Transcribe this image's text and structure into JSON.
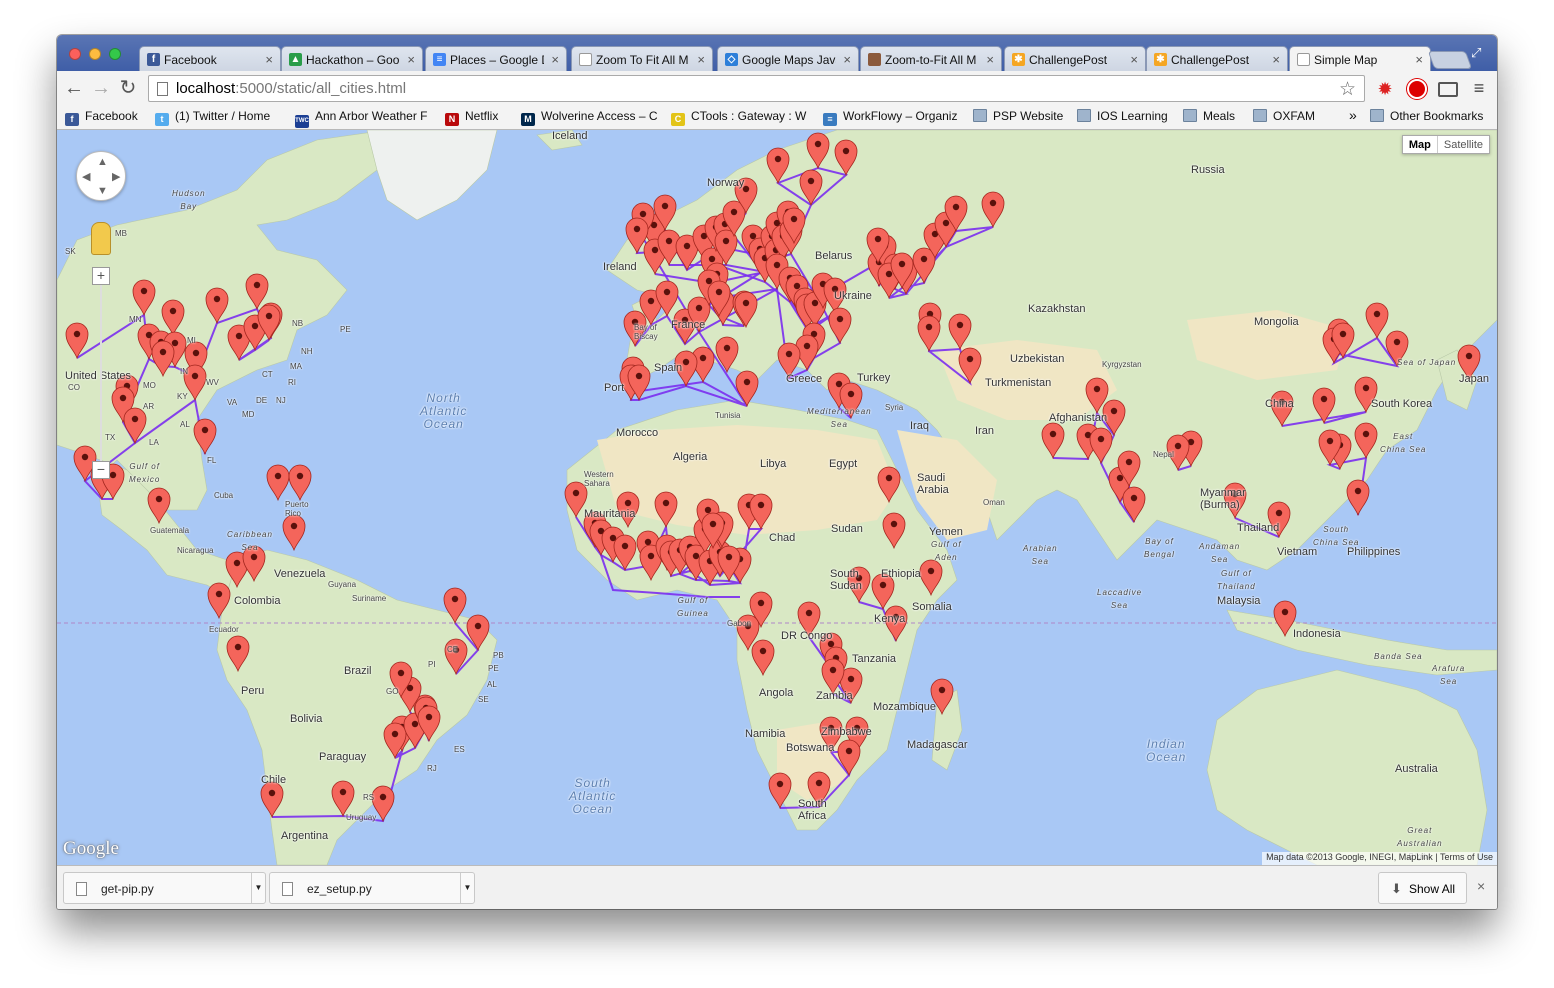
{
  "browser": {
    "tabs": [
      {
        "title": "Facebook",
        "favicon": "facebook-icon",
        "color": "#3b5998",
        "glyph": "f"
      },
      {
        "title": "Hackathon – Goo",
        "favicon": "google-drive-icon",
        "color": "#2a9d4a",
        "glyph": "▲"
      },
      {
        "title": "Places – Google D",
        "favicon": "google-docs-icon",
        "color": "#4285f4",
        "glyph": "≡"
      },
      {
        "title": "Zoom To Fit All M",
        "favicon": "page-icon",
        "color": "#ffffff",
        "glyph": ""
      },
      {
        "title": "Google Maps Java",
        "favicon": "google-code-icon",
        "color": "#2d7fd9",
        "glyph": "◇"
      },
      {
        "title": "Zoom-to-Fit All M",
        "favicon": "avatar-icon",
        "color": "#8b5a3c",
        "glyph": ""
      },
      {
        "title": "ChallengePost",
        "favicon": "challengepost-icon",
        "color": "#f5a623",
        "glyph": "✱"
      },
      {
        "title": "ChallengePost",
        "favicon": "challengepost-icon",
        "color": "#f5a623",
        "glyph": "✱"
      },
      {
        "title": "Simple Map",
        "favicon": "page-icon",
        "color": "#ffffff",
        "glyph": "",
        "active": true
      }
    ],
    "omnibox": {
      "host": "localhost",
      "path": ":5000/static/all_cities.html"
    },
    "bookmarks": [
      {
        "label": "Facebook",
        "icon": "facebook-icon",
        "color": "#3b5998",
        "glyph": "f"
      },
      {
        "label": "(1) Twitter / Home",
        "icon": "twitter-icon",
        "color": "#55acee",
        "glyph": "t"
      },
      {
        "label": "Ann Arbor Weather F",
        "icon": "twc-icon",
        "color": "#1c3f94",
        "glyph": "TWC"
      },
      {
        "label": "Netflix",
        "icon": "netflix-icon",
        "color": "#b9090b",
        "glyph": "N"
      },
      {
        "label": "Wolverine Access – C",
        "icon": "umich-icon",
        "color": "#00274c",
        "glyph": "M"
      },
      {
        "label": "CTools : Gateway : W",
        "icon": "ctools-icon",
        "color": "#e3c417",
        "glyph": "C"
      },
      {
        "label": "WorkFlowy – Organiz",
        "icon": "workflowy-icon",
        "color": "#3a7bbf",
        "glyph": "≡"
      },
      {
        "label": "PSP Website",
        "icon": "folder-icon",
        "folder": true
      },
      {
        "label": "IOS Learning",
        "icon": "folder-icon",
        "folder": true
      },
      {
        "label": "Meals",
        "icon": "folder-icon",
        "folder": true
      },
      {
        "label": "OXFAM",
        "icon": "folder-icon",
        "folder": true
      }
    ],
    "bookmarks_overflow": "»",
    "other_bookmarks": "Other Bookmarks"
  },
  "map": {
    "maptype": {
      "map": "Map",
      "satellite": "Satellite"
    },
    "google_logo": "Google",
    "attribution": "Map data ©2013 Google, INEGI, MapLink",
    "terms": "Terms of Use",
    "zoom_in": "+",
    "zoom_out": "−",
    "labels": {
      "russia": "Russia",
      "norway": "Norway",
      "ireland": "Ireland",
      "iceland": "Iceland",
      "belarus": "Belarus",
      "ukraine": "Ukraine",
      "kazakhstan": "Kazakhstan",
      "mongolia": "Mongolia",
      "france": "France",
      "bay_of_biscay": "Bay of\nBiscay",
      "spain": "Spain",
      "portugal": "Port",
      "uzbekistan": "Uzbekistan",
      "kyrgyzstan": "Kyrgyzstan",
      "turkmenistan": "Turkmenistan",
      "turkey": "Turkey",
      "greece": "Greece",
      "sea_of_japan": "Sea of Japan",
      "japan": "Japan",
      "south_korea": "South Korea",
      "china": "China",
      "afghanistan": "Afghanistan",
      "iran": "Iran",
      "iraq": "Iraq",
      "syria": "Syria",
      "morocco": "Morocco",
      "tunisia": "Tunisia",
      "mediterranean": "Mediterranean\nSea",
      "algeria": "Algeria",
      "libya": "Libya",
      "egypt": "Egypt",
      "saudi_arabia": "Saudi\nArabia",
      "nepal": "Nepal",
      "east_china_sea": "East\nChina Sea",
      "oman": "Oman",
      "western_sahara": "Western\nSahara",
      "mauritania": "Mauritania",
      "chad": "Chad",
      "sudan": "Sudan",
      "yemen": "Yemen",
      "myanmar": "Myanmar\n(Burma)",
      "thailand": "Thailand",
      "south_china_sea": "South\nChina Sea",
      "philippines": "Philippines",
      "vietnam": "Vietnam",
      "andaman_sea": "Andaman\nSea",
      "bay_of_bengal": "Bay of\nBengal",
      "arabian_sea": "Arabian\nSea",
      "gulf_of_aden": "Gulf of\nAden",
      "ethiopia": "Ethiopia",
      "south_sudan": "South\nSudan",
      "gulf_of_guinea": "Gulf of\nGuinea",
      "somalia": "Somalia",
      "gulf_of_thailand": "Gulf of\nThailand",
      "malaysia": "Malaysia",
      "gabon": "Gabon",
      "dr_congo": "DR Congo",
      "kenya": "Kenya",
      "laccadive_sea": "Laccadive\nSea",
      "indonesia": "Indonesia",
      "tanzania": "Tanzania",
      "banda_sea": "Banda Sea",
      "arafura_sea": "Arafura\nSea",
      "angola": "Angola",
      "zambia": "Zambia",
      "mozambique": "Mozambique",
      "madagascar": "Madagascar",
      "namibia": "Namibia",
      "zimbabwe": "Zimbabwe",
      "botswana": "Botswana",
      "indian_ocean": "Indian\nOcean",
      "australia": "Australia",
      "south_africa": "South\nAfrica",
      "great_australian_bight": "Great\nAustralian\nBight",
      "south_atlantic": "South\nAtlantic\nOcean",
      "north_atlantic": "North\nAtlantic\nOcean",
      "hudson_bay": "Hudson\nBay",
      "united_states": "United States",
      "cuba": "Cuba",
      "puerto_rico": "Puerto\nRico",
      "gulf_of_mexico": "Gulf of\nMexico",
      "caribbean": "Caribbean\nSea",
      "guatemala": "Guatemala",
      "nicaragua": "Nicaragua",
      "venezuela": "Venezuela",
      "guyana": "Guyana",
      "suriname": "Suriname",
      "colombia": "Colombia",
      "ecuador": "Ecuador",
      "brazil": "Brazil",
      "peru": "Peru",
      "bolivia": "Bolivia",
      "paraguay": "Paraguay",
      "chile": "Chile",
      "argentina": "Argentina",
      "uruguay": "Uruguay",
      "mb": "MB",
      "sk": "SK",
      "mn": "MN",
      "mi": "MI",
      "nb": "NB",
      "pe": "PE",
      "nh": "NH",
      "ma": "MA",
      "ct": "CT",
      "ri": "RI",
      "nj": "NJ",
      "de": "DE",
      "md": "MD",
      "va": "VA",
      "wv": "WV",
      "in": "IN",
      "mo": "MO",
      "ar": "AR",
      "ky": "KY",
      "la": "LA",
      "al": "AL",
      "fl": "FL",
      "co": "CO",
      "tx": "TX",
      "ce": "CE",
      "pi": "PI",
      "pb": "PB",
      "pe_br": "PE",
      "al_br": "AL",
      "se": "SE",
      "go": "GO",
      "es": "ES",
      "rj": "RJ",
      "rs": "RS"
    }
  },
  "downloads": {
    "items": [
      "get-pip.py",
      "ez_setup.py"
    ],
    "show_all": "Show All",
    "close": "×"
  }
}
